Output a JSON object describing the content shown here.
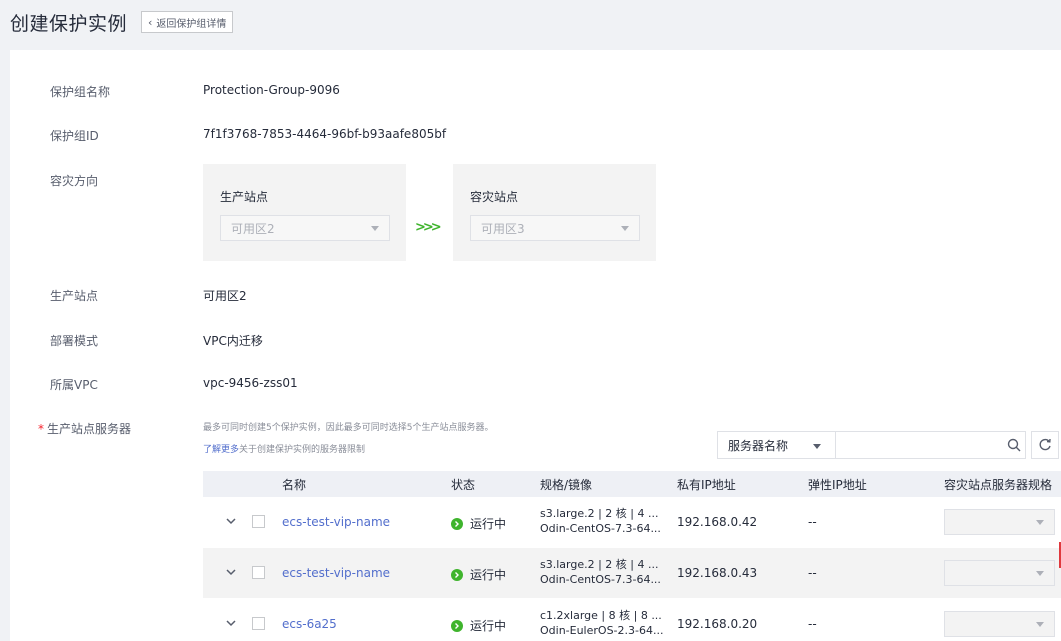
{
  "header": {
    "title": "创建保护实例",
    "back_label": "返回保护组详情"
  },
  "form": {
    "group_name_label": "保护组名称",
    "group_name_value": "Protection-Group-9096",
    "group_id_label": "保护组ID",
    "group_id_value": "7f1f3768-7853-4464-96bf-b93aafe805bf",
    "dr_direction_label": "容灾方向",
    "production_site_title": "生产站点",
    "production_site_value": "可用区2",
    "dr_site_title": "容灾站点",
    "dr_site_value": "可用区3",
    "prod_site_label": "生产站点",
    "prod_site_value": "可用区2",
    "deploy_mode_label": "部署模式",
    "deploy_mode_value": "VPC内迁移",
    "vpc_label": "所属VPC",
    "vpc_value": "vpc-9456-zss01",
    "servers_label": "生产站点服务器",
    "required_mark": "*",
    "hint": "最多可同时创建5个保护实例，因此最多可同时选择5个生产站点服务器。",
    "learn_more": "了解更多",
    "learn_more_suffix": "关于创建保护实例的服务器限制"
  },
  "search": {
    "filter_label": "服务器名称",
    "placeholder": ""
  },
  "table": {
    "headers": [
      "名称",
      "状态",
      "规格/镜像",
      "私有IP地址",
      "弹性IP地址",
      "容灾站点服务器规格"
    ],
    "rows": [
      {
        "name": "ecs-test-vip-name",
        "status": "运行中",
        "spec": "s3.large.2 | 2 核 | 4 ...",
        "image": "Odin-CentOS-7.3-64...",
        "ip": "192.168.0.42",
        "eip": "--"
      },
      {
        "name": "ecs-test-vip-name",
        "status": "运行中",
        "spec": "s3.large.2 | 2 核 | 4 ...",
        "image": "Odin-CentOS-7.3-64...",
        "ip": "192.168.0.43",
        "eip": "--"
      },
      {
        "name": "ecs-6a25",
        "status": "运行中",
        "spec": "c1.2xlarge | 8 核 | 8 ...",
        "image": "Odin-EulerOS-2.3-64...",
        "ip": "192.168.0.20",
        "eip": "--"
      }
    ]
  },
  "colors": {
    "accent": "#526ecc",
    "success": "#3fb42d",
    "required": "#f5222d"
  }
}
